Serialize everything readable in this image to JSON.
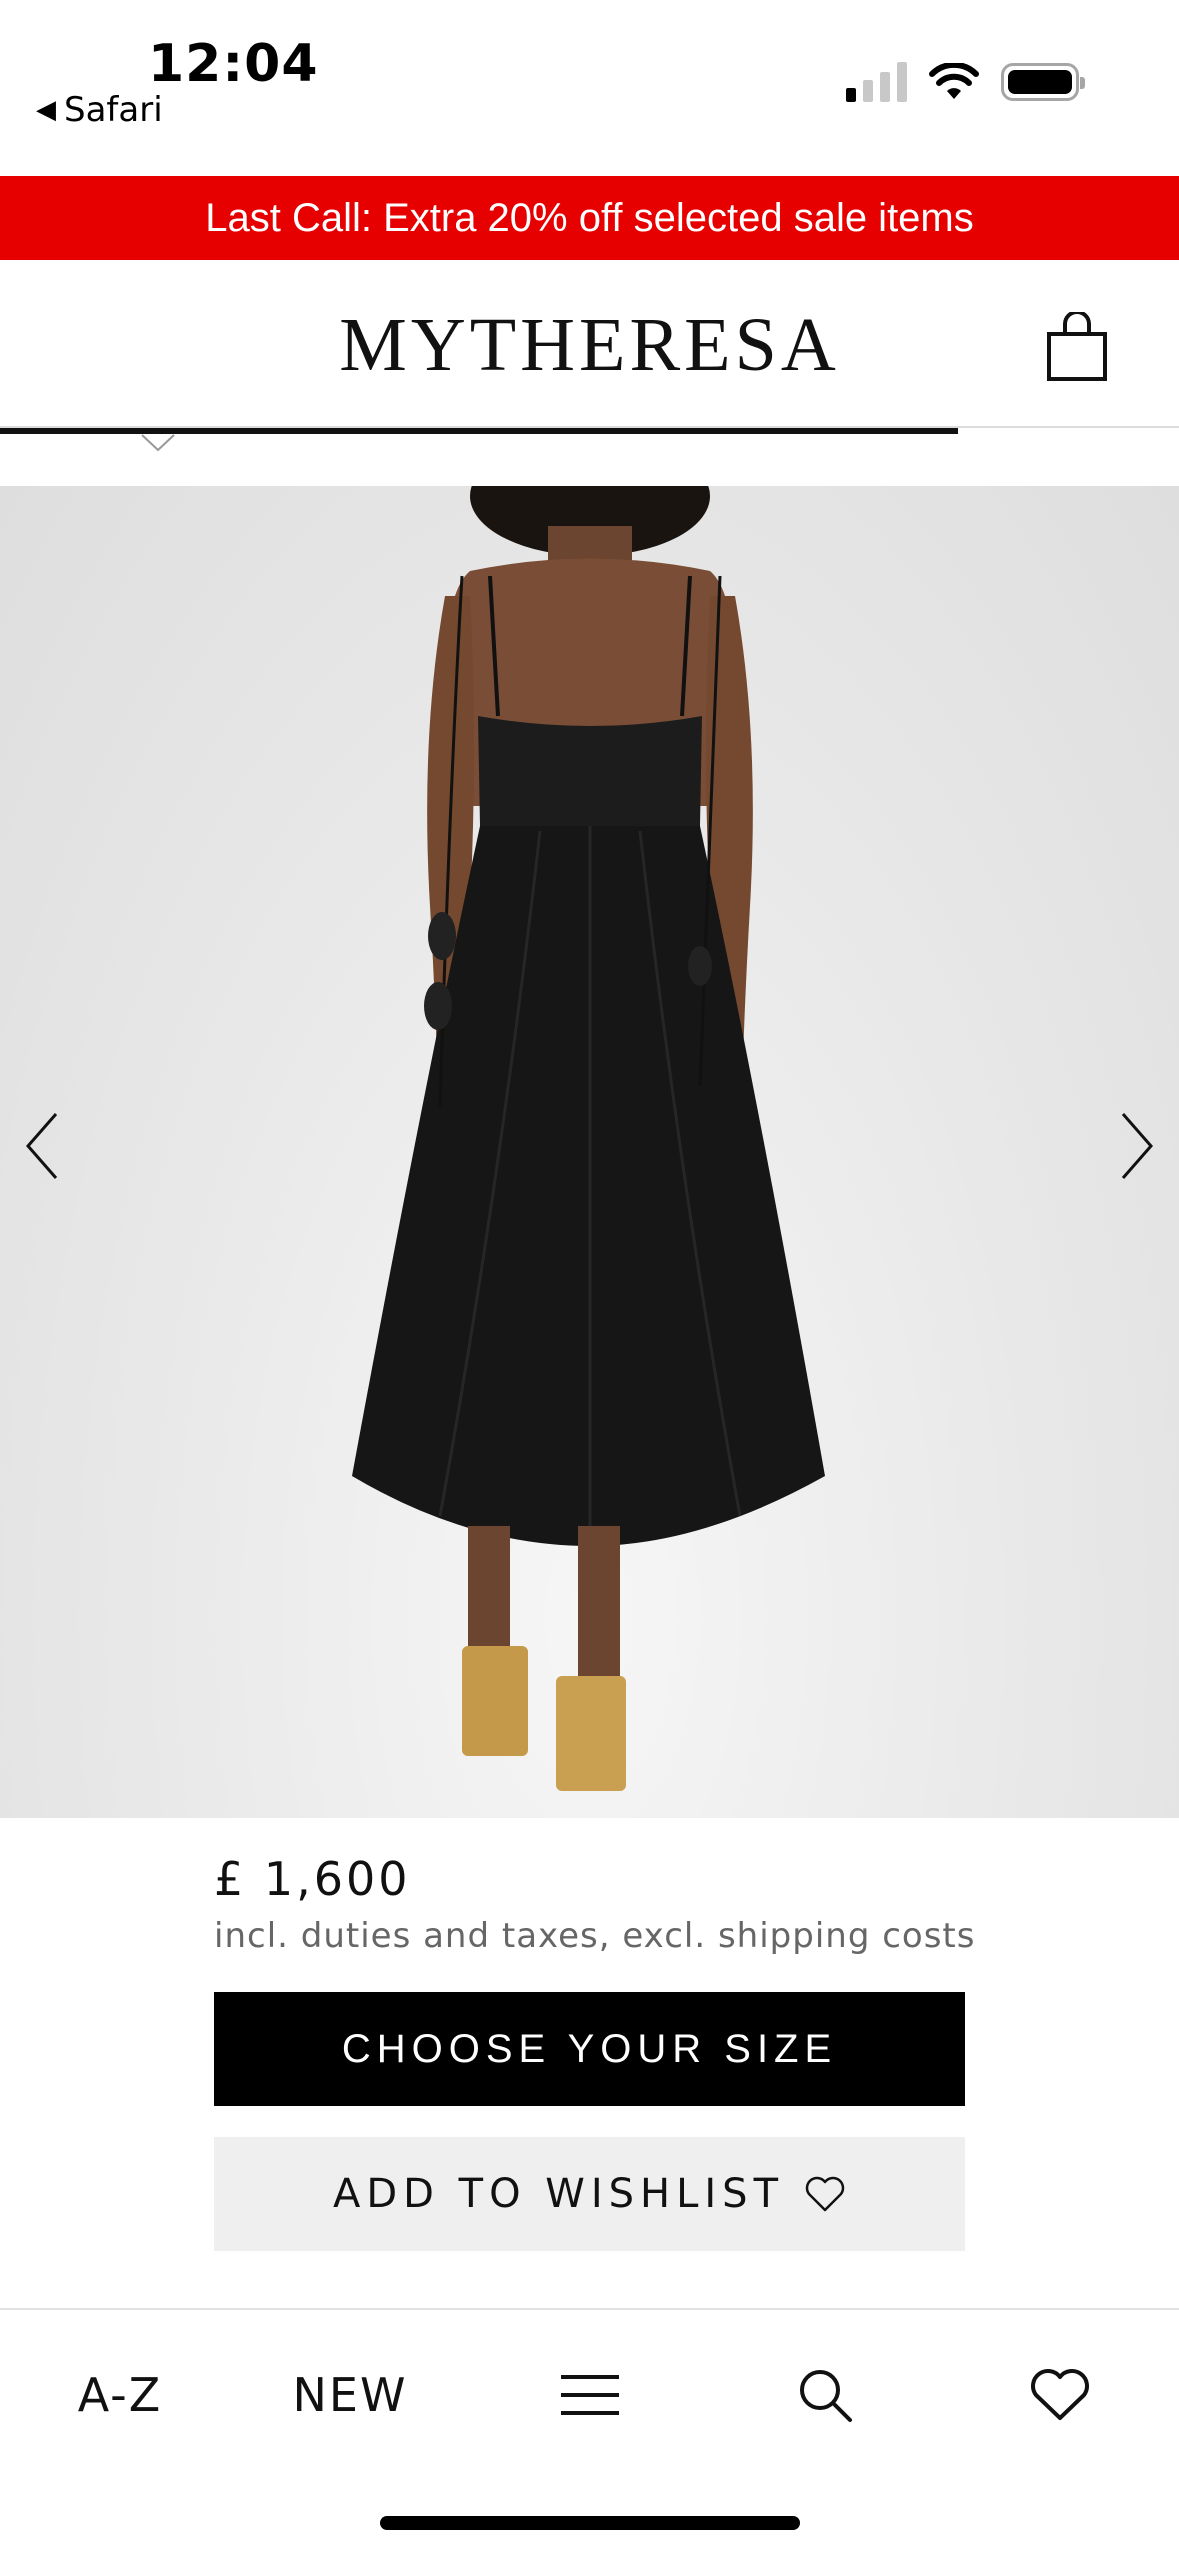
{
  "status_bar": {
    "time": "12:04",
    "back_app": "Safari"
  },
  "promo": {
    "text": "Last Call: Extra 20% off selected sale items",
    "background": "#e60000"
  },
  "header": {
    "logo": "MYTHERESA"
  },
  "product": {
    "price": "£ 1,600",
    "price_note": "incl. duties and taxes, excl. shipping costs",
    "choose_size_label": "CHOOSE YOUR SIZE",
    "wishlist_label": "ADD TO WISHLIST"
  },
  "icons": [
    "shopping-bag-icon",
    "chevron-left-icon",
    "chevron-right-icon",
    "heart-icon",
    "menu-icon",
    "search-icon",
    "wishlist-icon"
  ],
  "bottom_nav": {
    "az_label": "A-Z",
    "new_label": "NEW"
  }
}
